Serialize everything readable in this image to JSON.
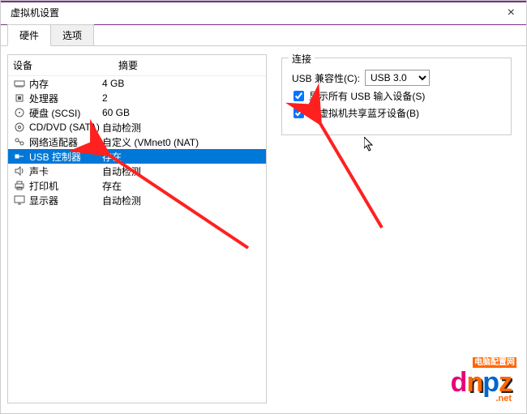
{
  "window": {
    "title": "虚拟机设置",
    "close": "×"
  },
  "tabs": {
    "hardware": "硬件",
    "options": "选项"
  },
  "columns": {
    "device": "设备",
    "summary": "摘要"
  },
  "devices": {
    "memory": {
      "name": "内存",
      "summary": "4 GB"
    },
    "cpu": {
      "name": "处理器",
      "summary": "2"
    },
    "disk": {
      "name": "硬盘 (SCSI)",
      "summary": "60 GB"
    },
    "cddvd": {
      "name": "CD/DVD (SATA)",
      "summary": "自动检测"
    },
    "net": {
      "name": "网络适配器",
      "summary": "自定义 (VMnet0 (NAT)"
    },
    "usb": {
      "name": "USB 控制器",
      "summary": "存在"
    },
    "sound": {
      "name": "声卡",
      "summary": "自动检测"
    },
    "printer": {
      "name": "打印机",
      "summary": "存在"
    },
    "display": {
      "name": "显示器",
      "summary": "自动检测"
    }
  },
  "connection": {
    "group": "连接",
    "compat_label": "USB 兼容性(C):",
    "compat_value": "USB 3.0",
    "show_all": "显示所有 USB 输入设备(S)",
    "share_bt": "与虚拟机共享蓝牙设备(B)"
  },
  "watermark": {
    "main": "dnpz",
    "sub": ".net",
    "tag": "电脑配置网"
  }
}
